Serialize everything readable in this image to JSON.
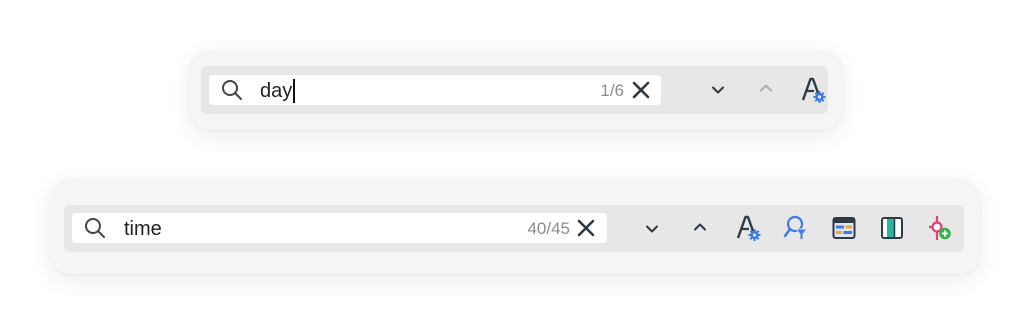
{
  "top_find_bar": {
    "query": "day",
    "match_count": "1/6",
    "search_icon": "search-icon",
    "clear_icon": "close-icon",
    "buttons": [
      {
        "name": "next-match-button",
        "icon": "chevron-down-icon",
        "enabled": true
      },
      {
        "name": "previous-match-button",
        "icon": "chevron-up-icon",
        "enabled": false
      },
      {
        "name": "search-options-button",
        "icon": "text-settings-icon",
        "enabled": true
      }
    ]
  },
  "bottom_find_bar": {
    "query": "time",
    "match_count": "40/45",
    "search_icon": "search-icon",
    "clear_icon": "close-icon",
    "buttons": [
      {
        "name": "next-match-button",
        "icon": "chevron-down-icon",
        "enabled": true
      },
      {
        "name": "previous-match-button",
        "icon": "chevron-up-icon",
        "enabled": true
      },
      {
        "name": "search-options-button",
        "icon": "text-settings-icon",
        "enabled": true
      },
      {
        "name": "filter-search-button",
        "icon": "search-filter-icon",
        "enabled": true
      },
      {
        "name": "table-view-button",
        "icon": "table-icon",
        "enabled": true
      },
      {
        "name": "split-view-button",
        "icon": "panel-split-icon",
        "enabled": true
      },
      {
        "name": "add-marker-button",
        "icon": "marker-add-icon",
        "enabled": true
      }
    ]
  },
  "colors": {
    "accent_blue": "#3f7ae6",
    "dark_icon": "#2f3a44",
    "disabled_icon": "#a9b0b7",
    "teal": "#27b5a8",
    "pink": "#e0407a",
    "green": "#36b24a"
  }
}
